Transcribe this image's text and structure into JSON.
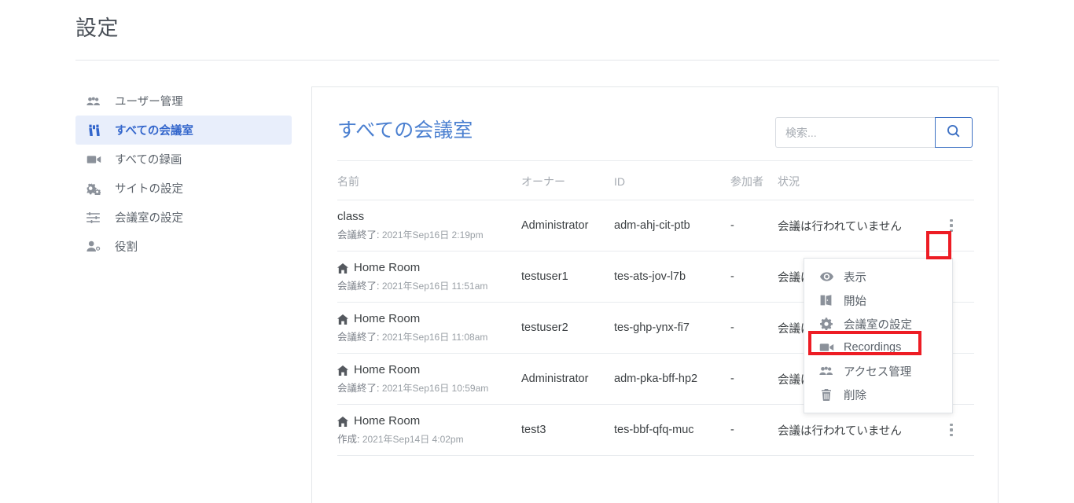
{
  "header": {
    "title": "設定"
  },
  "sidebar": {
    "items": [
      {
        "label": "ユーザー管理",
        "icon": "users-icon",
        "active": false
      },
      {
        "label": "すべての会議室",
        "icon": "binoculars-icon",
        "active": true
      },
      {
        "label": "すべての録画",
        "icon": "video-camera-icon",
        "active": false
      },
      {
        "label": "サイトの設定",
        "icon": "gears-icon",
        "active": false
      },
      {
        "label": "会議室の設定",
        "icon": "sliders-icon",
        "active": false
      },
      {
        "label": "役割",
        "icon": "user-tag-icon",
        "active": false
      }
    ]
  },
  "panel": {
    "title": "すべての会議室",
    "search": {
      "value": "",
      "placeholder": "検索...",
      "button_icon": "search-icon"
    },
    "table": {
      "columns": [
        "名前",
        "オーナー",
        "ID",
        "参加者",
        "状況"
      ],
      "rows": [
        {
          "name": "class",
          "has_home_icon": false,
          "sub_label": "会議終了:",
          "sub_value": "2021年Sep16日 2:19pm",
          "owner": "Administrator",
          "id": "adm-ahj-cit-ptb",
          "participants": "-",
          "status": "会議は行われていません"
        },
        {
          "name": "Home Room",
          "has_home_icon": true,
          "sub_label": "会議終了:",
          "sub_value": "2021年Sep16日 11:51am",
          "owner": "testuser1",
          "id": "tes-ats-jov-l7b",
          "participants": "-",
          "status": "会議は行われていません"
        },
        {
          "name": "Home Room",
          "has_home_icon": true,
          "sub_label": "会議終了:",
          "sub_value": "2021年Sep16日 11:08am",
          "owner": "testuser2",
          "id": "tes-ghp-ynx-fi7",
          "participants": "-",
          "status": "会議は行われていません"
        },
        {
          "name": "Home Room",
          "has_home_icon": true,
          "sub_label": "会議終了:",
          "sub_value": "2021年Sep16日 10:59am",
          "owner": "Administrator",
          "id": "adm-pka-bff-hp2",
          "participants": "-",
          "status": "会議は行われていません"
        },
        {
          "name": "Home Room",
          "has_home_icon": true,
          "sub_label": "作成:",
          "sub_value": "2021年Sep14日 4:02pm",
          "owner": "test3",
          "id": "tes-bbf-qfq-muc",
          "participants": "-",
          "status": "会議は行われていません"
        }
      ]
    }
  },
  "dropdown": {
    "items": [
      {
        "label": "表示",
        "icon": "eye-icon"
      },
      {
        "label": "開始",
        "icon": "door-open-icon"
      },
      {
        "label": "会議室の設定",
        "icon": "gear-icon"
      },
      {
        "label": "Recordings",
        "icon": "video-camera-icon"
      },
      {
        "label": "アクセス管理",
        "icon": "users-icon"
      },
      {
        "label": "削除",
        "icon": "trash-icon"
      }
    ],
    "highlighted_index": 3
  },
  "colors": {
    "accent_blue": "#3366cc",
    "title_blue": "#4a7fd0",
    "highlight_red": "#ed1c24",
    "active_nav_bg": "#e8eefb"
  }
}
